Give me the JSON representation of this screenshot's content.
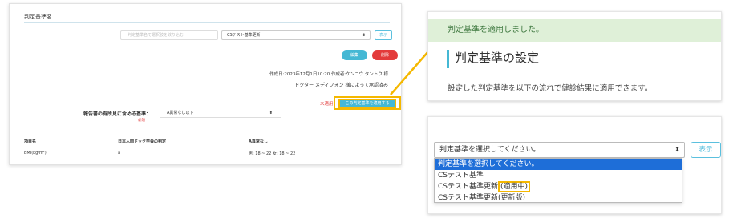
{
  "left": {
    "title": "判定基準名",
    "search_placeholder": "判定基準名で選択肢を絞り込む",
    "select_value": "CSテスト基準更新",
    "show_label": "表示",
    "edit_label": "編集",
    "delete_label": "削除",
    "created_text": "作成日:2023年12月1日10:20 作成者:ケンコウ タントウ 様",
    "approved_text": "ドクター メディフォン 様によって承認済み",
    "unapplied_label": "未適用",
    "apply_label": "この判定基準を適用する",
    "report_label": "報告書の有所見に含める基準：",
    "required_label": "必須",
    "criteria_value": "A異常なし以下",
    "table": {
      "headers": [
        "項目名",
        "日本人間ドック学会の判定",
        "A異常なし"
      ],
      "rows": [
        [
          "BMI(kg/m²)",
          "a",
          "男: 18 ~ 22 女: 18 ~ 22"
        ]
      ]
    }
  },
  "right_top": {
    "alert": "判定基準を適用しました。",
    "heading": "判定基準の設定",
    "description": "設定した判定基準を以下の流れで健診結果に適用できます。"
  },
  "right_bottom": {
    "select_value": "判定基準を選択してください。",
    "show_label": "表示",
    "options": {
      "o0": "判定基準を選択してください。",
      "o1": "CSテスト基準",
      "o2_prefix": "CSテスト基準更新",
      "o2_tag": "(適用中)",
      "o3": "CSテスト基準更新(更新版)"
    }
  },
  "colors": {
    "accent": "#45b8d4",
    "danger": "#e33b3b",
    "highlight": "#f5b800",
    "selected": "#1e6ed8",
    "success_bg": "#dff0d8"
  }
}
